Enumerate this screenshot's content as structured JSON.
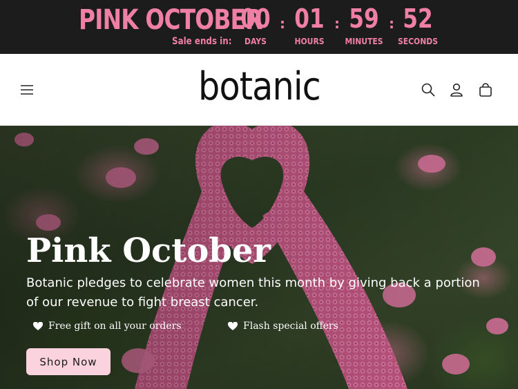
{
  "countdown": {
    "title": "PINK OCTOBER",
    "sale_ends_label": "Sale ends in:",
    "units": [
      {
        "value": "00",
        "label": "DAYS"
      },
      {
        "value": "01",
        "label": "HOURS"
      },
      {
        "value": "59",
        "label": "MINUTES"
      },
      {
        "value": "52",
        "label": "SECONDS"
      }
    ],
    "separator": ":",
    "color": "#f07fa5",
    "background": "#1c1c1c"
  },
  "header": {
    "logo": "botanic",
    "icons": {
      "menu": "hamburger-menu-icon",
      "search": "search-icon",
      "account": "account-icon",
      "cart": "cart-icon"
    }
  },
  "hero": {
    "title": "Pink October",
    "subtitle": "Botanic pledges to celebrate women this month by giving back a portion of our revenue to fight breast cancer.",
    "features": [
      {
        "icon": "heart-icon",
        "label": "Free gift on all your orders"
      },
      {
        "icon": "heart-icon",
        "label": "Flash special offers"
      }
    ],
    "cta_label": "Shop Now",
    "cta_color": "#fbd3df"
  }
}
